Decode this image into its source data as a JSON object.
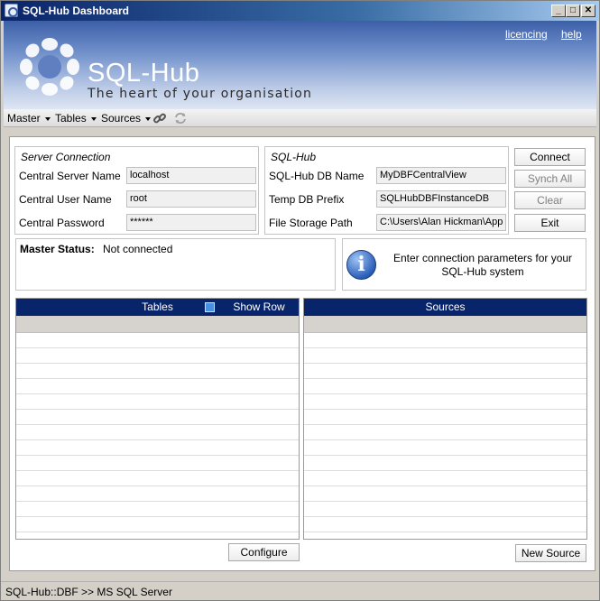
{
  "window": {
    "title": "SQL-Hub Dashboard",
    "controls": {
      "minimize": "_",
      "maximize": "□",
      "close": "✕"
    }
  },
  "banner": {
    "brand": "SQL-Hub",
    "tagline": "The heart of your organisation",
    "links": {
      "licencing": "licencing",
      "help": "help"
    },
    "logo_icon": "sqlhub-logo-icon"
  },
  "menu": {
    "items": [
      {
        "label": "Master"
      },
      {
        "label": "Tables"
      },
      {
        "label": "Sources"
      }
    ],
    "icons": [
      "link-icon",
      "refresh-icon"
    ]
  },
  "server_connection": {
    "title": "Server Connection",
    "server_name_label": "Central Server Name",
    "server_name_value": "localhost",
    "user_name_label": "Central User Name",
    "user_name_value": "root",
    "password_label": "Central Password",
    "password_value": "******"
  },
  "sqlhub": {
    "title": "SQL-Hub",
    "db_name_label": "SQL-Hub DB Name",
    "db_name_value": "MyDBFCentralView",
    "prefix_label": "Temp DB Prefix",
    "prefix_value": "SQLHubDBFInstanceDB",
    "storage_label": "File Storage Path",
    "storage_value": "C:\\Users\\Alan Hickman\\App"
  },
  "actions": {
    "connect": "Connect",
    "synch_all": "Synch All",
    "clear": "Clear",
    "exit": "Exit"
  },
  "status": {
    "label": "Master Status:",
    "value": "Not connected"
  },
  "info": {
    "icon": "info-icon",
    "glyph": "i",
    "message": "Enter connection parameters for your SQL-Hub system"
  },
  "tables_panel": {
    "header": "Tables",
    "show_row_count": "Show Row Count",
    "configure_button": "Configure"
  },
  "sources_panel": {
    "header": "Sources",
    "new_source_button": "New Source"
  },
  "statusbar": {
    "text": "SQL-Hub::DBF >> MS SQL Server"
  },
  "colors": {
    "panel_header": "#08246b",
    "title_bar": "#0a246a",
    "banner_top": "#3d5fa8"
  }
}
